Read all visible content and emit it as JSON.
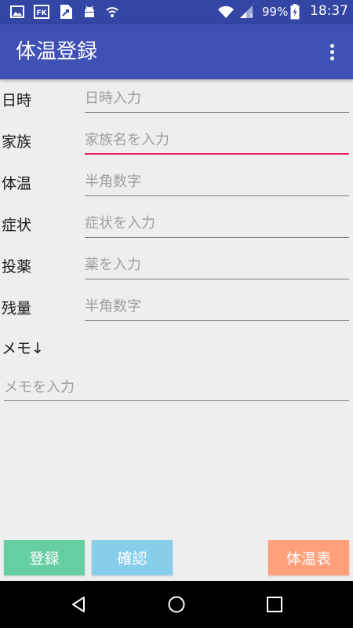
{
  "status_bar": {
    "battery_percent": "99%",
    "time": "18:37",
    "left_icons": [
      "image-icon",
      "fk-app-icon",
      "file-transfer-icon",
      "android-icon",
      "wifi-calling-icon"
    ],
    "right_icons": [
      "wifi-icon",
      "signal-icon",
      "battery-icon"
    ]
  },
  "app_bar": {
    "title": "体温登録",
    "menu_icon": "overflow-menu-icon"
  },
  "form": {
    "rows": [
      {
        "label": "日時",
        "placeholder": "日時入力"
      },
      {
        "label": "家族",
        "placeholder": "家族名を入力"
      },
      {
        "label": "体温",
        "placeholder": "半角数字"
      },
      {
        "label": "症状",
        "placeholder": "症状を入力"
      },
      {
        "label": "投薬",
        "placeholder": "薬を入力"
      },
      {
        "label": "残量",
        "placeholder": "半角数字"
      }
    ],
    "memo_label": "メモ↓",
    "memo_placeholder": "メモを入力"
  },
  "buttons": {
    "register": "登録",
    "confirm": "確認",
    "temperature_table": "体温表"
  },
  "colors": {
    "app_bar": "#3f51b5",
    "status_bar": "#3345a5",
    "focus_underline": "#e91e63",
    "register_button": "#66cfa2",
    "confirm_button": "#87ceeb",
    "table_button": "#ffa07a"
  },
  "nav_bar": {
    "icons": [
      "back-icon",
      "home-icon",
      "recents-icon"
    ]
  }
}
